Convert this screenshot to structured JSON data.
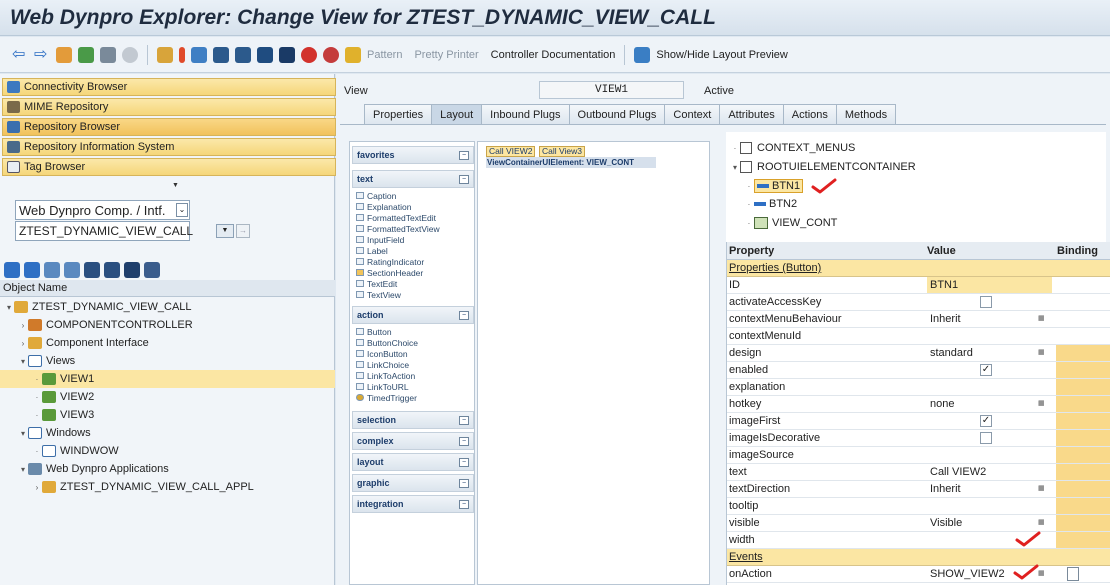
{
  "title": "Web Dynpro Explorer: Change View for ZTEST_DYNAMIC_VIEW_CALL",
  "toolbar": {
    "pattern": "Pattern",
    "pretty_printer": "Pretty Printer",
    "controller_doc": "Controller Documentation",
    "show_hide": "Show/Hide Layout Preview"
  },
  "nav": {
    "connectivity": "Connectivity Browser",
    "mime": "MIME Repository",
    "repository": "Repository Browser",
    "repo_info": "Repository Information System",
    "tag": "Tag Browser"
  },
  "object_type": "Web Dynpro Comp. / Intf.",
  "object_name": "ZTEST_DYNAMIC_VIEW_CALL",
  "tree_header": "Object Name",
  "tree": [
    "ZTEST_DYNAMIC_VIEW_CALL",
    "COMPONENTCONTROLLER",
    "Component Interface",
    "Views",
    "VIEW1",
    "VIEW2",
    "VIEW3",
    "Windows",
    "WINDWOW",
    "Web Dynpro Applications",
    "ZTEST_DYNAMIC_VIEW_CALL_APPL"
  ],
  "view_label": "View",
  "view_name": "VIEW1",
  "status": "Active",
  "tabs": [
    "Properties",
    "Layout",
    "Inbound Plugs",
    "Outbound Plugs",
    "Context",
    "Attributes",
    "Actions",
    "Methods"
  ],
  "palette": {
    "favorites": "favorites",
    "text": "text",
    "text_items": [
      "Caption",
      "Explanation",
      "FormattedTextEdit",
      "FormattedTextView",
      "InputField",
      "Label",
      "RatingIndicator",
      "SectionHeader",
      "TextEdit",
      "TextView"
    ],
    "action": "action",
    "action_items": [
      "Button",
      "ButtonChoice",
      "IconButton",
      "LinkChoice",
      "LinkToAction",
      "LinkToURL",
      "TimedTrigger"
    ],
    "selection": "selection",
    "complex": "complex",
    "layout": "layout",
    "graphic": "graphic",
    "integration": "integration"
  },
  "canvas": {
    "btn1": "Call VIEW2",
    "btn2": "Call View3",
    "container": "ViewContainerUIElement: VIEW_CONT"
  },
  "ui_tree": [
    "CONTEXT_MENUS",
    "ROOTUIELEMENTCONTAINER",
    "BTN1",
    "BTN2",
    "VIEW_CONT"
  ],
  "prop_header": {
    "property": "Property",
    "value": "Value",
    "binding": "Binding"
  },
  "prop_section": "Properties (Button)",
  "properties": [
    {
      "name": "ID",
      "value": "BTN1"
    },
    {
      "name": "activateAccessKey",
      "value": ""
    },
    {
      "name": "contextMenuBehaviour",
      "value": "Inherit"
    },
    {
      "name": "contextMenuId",
      "value": ""
    },
    {
      "name": "design",
      "value": "standard"
    },
    {
      "name": "enabled",
      "value": ""
    },
    {
      "name": "explanation",
      "value": ""
    },
    {
      "name": "hotkey",
      "value": "none"
    },
    {
      "name": "imageFirst",
      "value": ""
    },
    {
      "name": "imageIsDecorative",
      "value": ""
    },
    {
      "name": "imageSource",
      "value": ""
    },
    {
      "name": "text",
      "value": "Call VIEW2"
    },
    {
      "name": "textDirection",
      "value": "Inherit"
    },
    {
      "name": "tooltip",
      "value": ""
    },
    {
      "name": "visible",
      "value": "Visible"
    },
    {
      "name": "width",
      "value": ""
    }
  ],
  "events_section": "Events",
  "event": {
    "name": "onAction",
    "value": "SHOW_VIEW2"
  },
  "colors": {
    "accent_yellow": "#fbe6a3",
    "check_red": "#e02020",
    "binding_yellow": "#f9d98a"
  }
}
